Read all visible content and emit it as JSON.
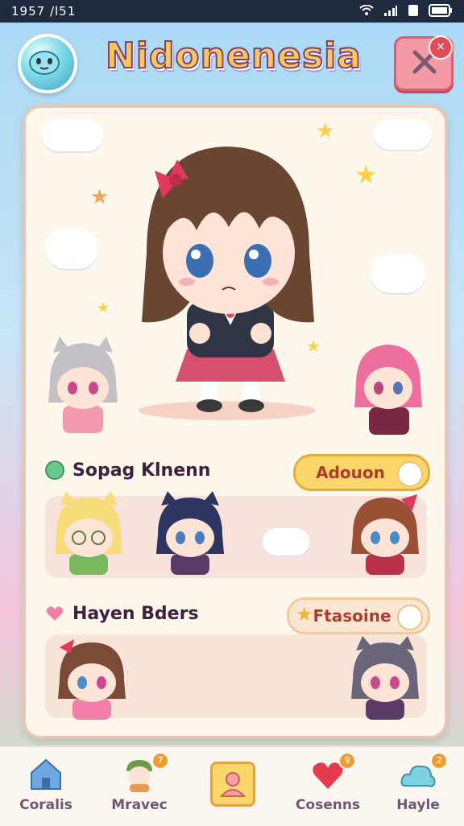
{
  "status_bar": {
    "time": "1957 /l51",
    "icons": [
      "wifi-icon",
      "signal-icon",
      "sim-icon",
      "battery-icon"
    ]
  },
  "header": {
    "title": "Nidonenesia",
    "close_badge": "×"
  },
  "sections": [
    {
      "title": "Sopag Klnenn",
      "button": "Adouon",
      "icon": "gem-icon"
    },
    {
      "title": "Hayen Bders",
      "button": "Ftasoine",
      "icon": "heart-icon"
    }
  ],
  "nav": [
    {
      "label": "Coralis",
      "icon": "home-icon"
    },
    {
      "label": "Mravec",
      "icon": "character-icon",
      "badge": "7"
    },
    {
      "label": "",
      "icon": "profile-icon"
    },
    {
      "label": "Cosenns",
      "icon": "heart-balloon-icon",
      "badge": "9"
    },
    {
      "label": "Hayle",
      "icon": "cloud-icon",
      "badge": "2"
    }
  ],
  "colors": {
    "accent": "#f49aa6",
    "title_fill": "#f8c95a",
    "title_stroke": "#7b3f7e",
    "card_bg": "#fdf7ec"
  }
}
